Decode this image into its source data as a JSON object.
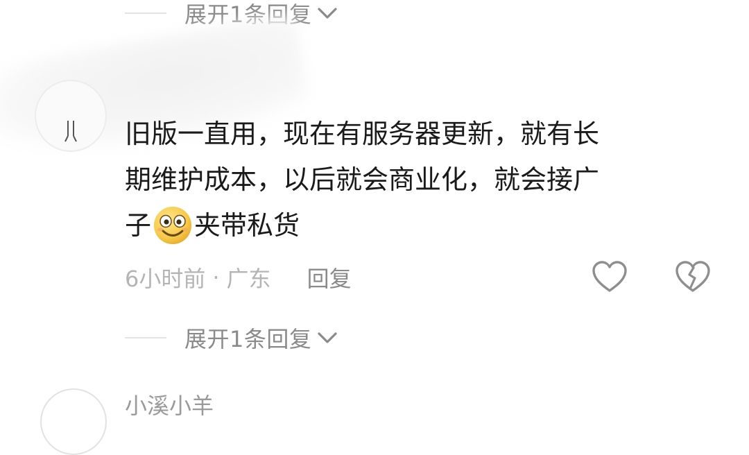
{
  "expand_replies_top": {
    "label": "展开1条回复"
  },
  "comment": {
    "text_line1": "旧版一直用，现在有服务器更新，就有长",
    "text_line2": "期维护成本，以后就会商业化，就会接广",
    "text_line3_before_emoji": "子",
    "text_line3_after_emoji": "夹带私货",
    "emoji_icon": "grinning-face-emoji",
    "time": "6小时前",
    "separator": "·",
    "location": "广东",
    "reply_label": "回复"
  },
  "expand_replies_bottom": {
    "label": "展开1条回复"
  },
  "next_comment": {
    "username_partial": "小溪小羊"
  },
  "colors": {
    "text_primary": "#1a1a1a",
    "text_secondary": "#8a8a8a",
    "text_meta": "#b4b4b4",
    "icon_gray": "#8e8e8e",
    "emoji_yellow": "#f7c948"
  }
}
